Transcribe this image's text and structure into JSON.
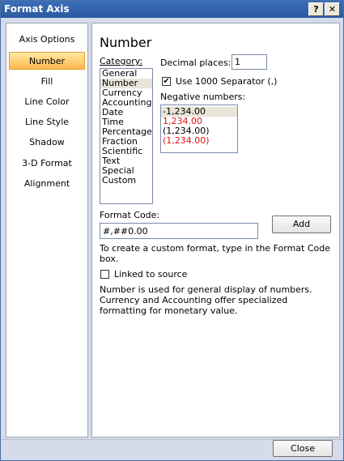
{
  "window": {
    "title": "Format Axis",
    "help_label": "?",
    "close_label": "✕"
  },
  "nav": {
    "items": [
      {
        "label": "Axis Options",
        "selected": false
      },
      {
        "label": "Number",
        "selected": true
      },
      {
        "label": "Fill",
        "selected": false
      },
      {
        "label": "Line Color",
        "selected": false
      },
      {
        "label": "Line Style",
        "selected": false
      },
      {
        "label": "Shadow",
        "selected": false
      },
      {
        "label": "3-D Format",
        "selected": false
      },
      {
        "label": "Alignment",
        "selected": false
      }
    ]
  },
  "number": {
    "heading": "Number",
    "category_label": "Category:",
    "categories": [
      "General",
      "Number",
      "Currency",
      "Accounting",
      "Date",
      "Time",
      "Percentage",
      "Fraction",
      "Scientific",
      "Text",
      "Special",
      "Custom"
    ],
    "selected_category": "Number",
    "decimal_places_label": "Decimal places:",
    "decimal_places_value": "1",
    "use_separator_label": "Use 1000 Separator (,)",
    "use_separator_checked": true,
    "negative_numbers_label": "Negative numbers:",
    "negative_numbers": [
      {
        "text": "-1,234.00",
        "red": false,
        "selected": true
      },
      {
        "text": "1,234.00",
        "red": true,
        "selected": false
      },
      {
        "text": "(1,234.00)",
        "red": false,
        "selected": false
      },
      {
        "text": "(1,234.00)",
        "red": true,
        "selected": false
      }
    ],
    "format_code_label": "Format Code:",
    "format_code_value": "#,##0.00",
    "add_button": "Add",
    "custom_hint": "To create a custom format, type in the Format Code box.",
    "linked_to_source_label": "Linked to source",
    "linked_to_source_checked": false,
    "description": "Number is used for general display of numbers. Currency and Accounting offer specialized formatting for monetary value."
  },
  "footer": {
    "close_button": "Close"
  }
}
